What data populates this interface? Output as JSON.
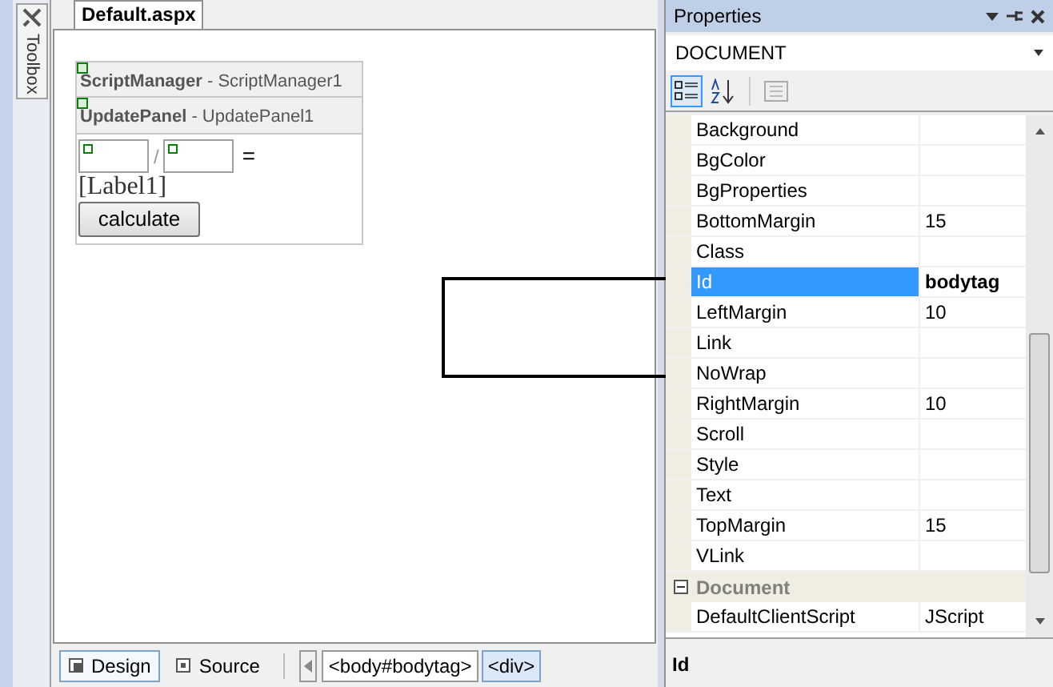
{
  "toolbox": {
    "label": "Toolbox"
  },
  "document_tab": {
    "label": "Default.aspx",
    "selected": true
  },
  "design_surface": {
    "script_manager": {
      "title": "**ScriptManager** - ScriptManager1"
    },
    "update_panel": {
      "title": "**UpdatePanel** - UpdatePanel1",
      "operator": "/",
      "equals": "=",
      "label": "[Label1]",
      "button": "calculate"
    }
  },
  "view_tabs": [
    {
      "label": "Design",
      "selected": true
    },
    {
      "label": "Source",
      "selected": false
    }
  ],
  "breadcrumbs": [
    {
      "label": "<body#bodytag>",
      "selected": false
    },
    {
      "label": "<div>",
      "selected": true
    }
  ],
  "properties": {
    "title": "Properties",
    "object": "DOCUMENT",
    "toolbar": [
      {
        "kind": "categorized",
        "selected": true
      },
      {
        "kind": "alphabetical",
        "selected": false
      },
      {
        "kind": "pages",
        "selected": false
      }
    ],
    "rows": [
      {
        "kind": "property",
        "name": "Background",
        "selected": false
      },
      {
        "kind": "property",
        "name": "BgColor",
        "selected": false
      },
      {
        "kind": "property",
        "name": "BgProperties",
        "selected": false
      },
      {
        "kind": "property",
        "name": "BottomMargin",
        "value": "15",
        "selected": false
      },
      {
        "kind": "property",
        "name": "Class",
        "selected": false
      },
      {
        "kind": "property",
        "name": "Id",
        "value": "bodytag",
        "selected": true
      },
      {
        "kind": "property",
        "name": "LeftMargin",
        "value": "10",
        "selected": false
      },
      {
        "kind": "property",
        "name": "Link",
        "selected": false
      },
      {
        "kind": "property",
        "name": "NoWrap",
        "selected": false
      },
      {
        "kind": "property",
        "name": "RightMargin",
        "value": "10",
        "selected": false
      },
      {
        "kind": "property",
        "name": "Scroll",
        "selected": false
      },
      {
        "kind": "property",
        "name": "Style",
        "selected": false
      },
      {
        "kind": "property",
        "name": "Text",
        "selected": false
      },
      {
        "kind": "property",
        "name": "TopMargin",
        "value": "15",
        "selected": false
      },
      {
        "kind": "property",
        "name": "VLink",
        "selected": false
      },
      {
        "kind": "category",
        "name": "Document",
        "expanded": true
      },
      {
        "kind": "property",
        "name": "DefaultClientScript",
        "value": "JScript",
        "selected": false
      }
    ],
    "description": "Id"
  }
}
